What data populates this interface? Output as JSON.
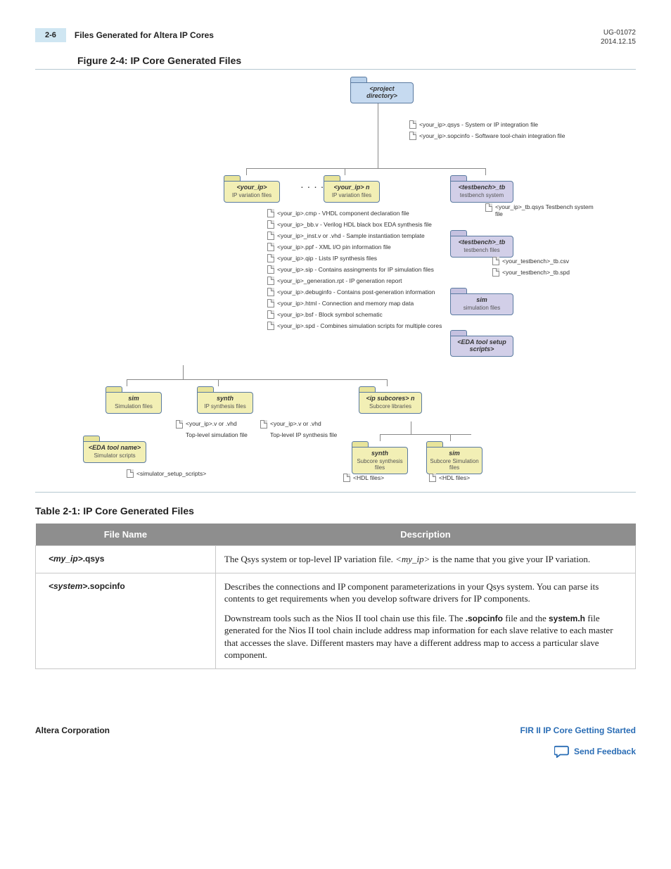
{
  "header": {
    "page_num": "2-6",
    "section": "Files Generated for Altera IP Cores",
    "doc_id": "UG-01072",
    "date": "2014.12.15"
  },
  "figure": {
    "title": "Figure 2-4: IP Core Generated Files",
    "folders": {
      "project_dir": {
        "name": "<project directory>"
      },
      "your_ip": {
        "name": "<your_ip>",
        "desc": "IP variation files"
      },
      "your_ip_n": {
        "name": "<your_ip> n",
        "desc": "IP variation files"
      },
      "testbench_tb": {
        "name": "<testbench>_tb",
        "desc": "testbench system"
      },
      "testbench_tb2": {
        "name": "<testbench>_tb",
        "desc": "testbench files"
      },
      "sim_purple": {
        "name": "sim",
        "desc": "simulation files"
      },
      "eda_scripts": {
        "name": "<EDA tool setup scripts>"
      },
      "sim": {
        "name": "sim",
        "desc": "Simulation files"
      },
      "synth": {
        "name": "synth",
        "desc": "IP synthesis files"
      },
      "ip_subcores": {
        "name": "<ip subcores> n",
        "desc": "Subcore libraries"
      },
      "eda_tool": {
        "name": "<EDA tool name>",
        "desc": "Simulator scripts"
      },
      "synth_sub": {
        "name": "synth",
        "desc": "Subcore synthesis files"
      },
      "sim_sub": {
        "name": "sim",
        "desc": "Subcore Simulation files"
      }
    },
    "files": {
      "qsys": "<your_ip>.qsys - System or IP integration file",
      "sopcinfo": "<your_ip>.sopcinfo - Software tool-chain integration file",
      "tb_qsys": "<your_ip>_tb.qsys Testbench system file",
      "cmp": "<your_ip>.cmp - VHDL component declaration file",
      "bbv": "<your_ip>_bb.v - Verilog HDL black box EDA synthesis file",
      "inst": "<your_ip>_inst.v or .vhd - Sample instantiation template",
      "ppf": "<your_ip>.ppf - XML I/O pin information file",
      "qip": "<your_ip>.qip - Lists IP synthesis files",
      "sip": "<your_ip>.sip - Contains assingments for IP simulation files",
      "genrpt": "<your_ip>_generation.rpt - IP generation report",
      "debuginfo": "<your_ip>.debuginfo - Contains post-generation information",
      "html": "<your_ip>.html - Connection and memory map data",
      "bsf": "<your_ip>.bsf - Block symbol schematic",
      "spd": "<your_ip>.spd - Combines simulation scripts for multiple cores",
      "tb_csv": "<your_testbench>_tb.csv",
      "tb_spd": "<your_testbench>_tb.spd",
      "sim_vhd": "<your_ip>.v or .vhd",
      "sim_vhd_desc": "Top-level simulation file",
      "synth_vhd": "<your_ip>.v or .vhd",
      "synth_vhd_desc": "Top-level IP synthesis file",
      "sim_scripts": "<simulator_setup_scripts>",
      "hdl1": "<HDL files>",
      "hdl2": "<HDL files>"
    },
    "dots": ". . . ."
  },
  "table": {
    "title": "Table 2-1: IP Core Generated Files",
    "headers": {
      "col1": "File Name",
      "col2": "Description"
    },
    "rows": [
      {
        "fname_prefix": "<my_ip>",
        "fname_suffix": ".qsys",
        "desc_p1_a": "The Qsys system or top-level IP variation file. ",
        "desc_p1_b": "<my_ip>",
        "desc_p1_c": " is the name that you give your IP variation."
      },
      {
        "fname_prefix": "<system>",
        "fname_suffix": ".sopcinfo",
        "desc_p1": "Describes the connections and IP component parameterizations in your Qsys system. You can parse its contents to get requirements when you develop software drivers for IP components.",
        "desc_p2_a": "Downstream tools such as the Nios II tool chain use this file. The ",
        "desc_p2_b": ".sopcinfo",
        "desc_p2_c": " file and the ",
        "desc_p2_d": "system.h",
        "desc_p2_e": " file generated for the Nios II tool chain include address map information for each slave relative to each master that accesses the slave. Different masters may have a different address map to access a particular slave component."
      }
    ]
  },
  "footer": {
    "left": "Altera Corporation",
    "right_link": "FIR II IP Core Getting Started",
    "feedback": "Send Feedback"
  }
}
